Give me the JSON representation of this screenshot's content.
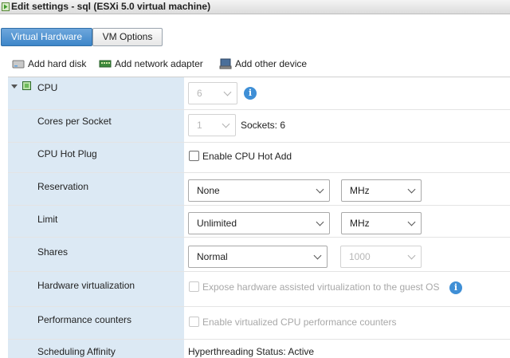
{
  "window": {
    "title": "Edit settings - sql (ESXi 5.0 virtual machine)"
  },
  "tabs": [
    {
      "label": "Virtual Hardware",
      "active": true
    },
    {
      "label": "VM Options",
      "active": false
    }
  ],
  "toolbar": {
    "add_hard_disk": "Add hard disk",
    "add_network_adapter": "Add network adapter",
    "add_other_device": "Add other device"
  },
  "cpu": {
    "label": "CPU",
    "count_value": "6",
    "cores_per_socket": {
      "label": "Cores per Socket",
      "value": "1",
      "sockets_text": "Sockets: 6"
    },
    "hot_plug": {
      "label": "CPU Hot Plug",
      "checkbox_label": "Enable CPU Hot Add",
      "checked": false
    },
    "reservation": {
      "label": "Reservation",
      "value": "None",
      "unit": "MHz"
    },
    "limit": {
      "label": "Limit",
      "value": "Unlimited",
      "unit": "MHz"
    },
    "shares": {
      "label": "Shares",
      "value": "Normal",
      "amount": "1000"
    },
    "hw_virtualization": {
      "label": "Hardware virtualization",
      "checkbox_label": "Expose hardware assisted virtualization to the guest OS",
      "checked": false
    },
    "perf_counters": {
      "label": "Performance counters",
      "checkbox_label": "Enable virtualized CPU performance counters",
      "checked": false
    },
    "scheduling_affinity": {
      "label": "Scheduling Affinity",
      "value": "Hyperthreading Status: Active"
    }
  },
  "colors": {
    "active_tab": "#3d86c9",
    "label_column": "#dce9f4",
    "info_icon": "#3f8fd6"
  }
}
